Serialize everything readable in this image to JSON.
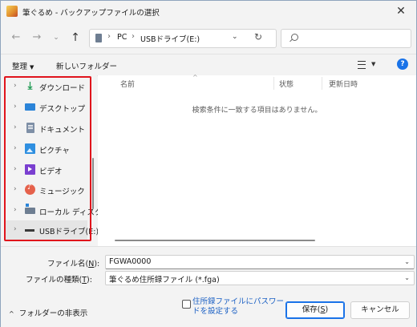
{
  "window": {
    "title": "筆ぐるめ - バックアップファイルの選択",
    "close_glyph": "✕"
  },
  "nav": {
    "back_glyph": "←",
    "forward_glyph": "→",
    "recent_glyph": "⌄",
    "up_glyph": "↑",
    "breadcrumb": [
      "PC",
      "USBドライブ(E:)"
    ],
    "breadcrumb_sep": "›",
    "dropdown_glyph": "⌄",
    "refresh_glyph": "↻"
  },
  "toolbar": {
    "organize_label": "整理",
    "organize_caret": "▼",
    "new_folder_label": "新しいフォルダー",
    "view_caret": "▼",
    "help_label": "?"
  },
  "sidebar": {
    "chevron": "›",
    "items": [
      {
        "label": "ダウンロード",
        "icon": "download-icon"
      },
      {
        "label": "デスクトップ",
        "icon": "desktop-icon"
      },
      {
        "label": "ドキュメント",
        "icon": "documents-icon"
      },
      {
        "label": "ピクチャ",
        "icon": "pictures-icon"
      },
      {
        "label": "ビデオ",
        "icon": "videos-icon"
      },
      {
        "label": "ミュージック",
        "icon": "music-icon"
      },
      {
        "label": "ローカル ディスク",
        "icon": "local-disk-icon"
      },
      {
        "label": "USBドライブ(E:)",
        "icon": "usb-drive-icon",
        "selected": true
      }
    ],
    "download_glyph": "⤓"
  },
  "content": {
    "columns": [
      "名前",
      "状態",
      "更新日時"
    ],
    "sort_glyph": "^",
    "empty_message": "検索条件に一致する項目はありません。"
  },
  "footer": {
    "filename_label": "ファイル名(",
    "filename_key": "N",
    "filename_suffix": "):",
    "filename_value": "FGWA0000",
    "filetype_label": "ファイルの種類(",
    "filetype_key": "T",
    "filetype_suffix": "):",
    "filetype_value": "筆ぐるめ住所録ファイル (*.fga)",
    "dropdown_glyph": "⌄",
    "hide_folders_caret": "^",
    "hide_folders_label": "フォルダーの非表示",
    "password_label": "住所録ファイルにパスワードを設定する",
    "save_label": "保存(",
    "save_key": "S",
    "save_suffix": ")",
    "cancel_label": "キャンセル"
  },
  "colors": {
    "accent": "#1a73e8",
    "highlight_border": "#e0141c"
  }
}
